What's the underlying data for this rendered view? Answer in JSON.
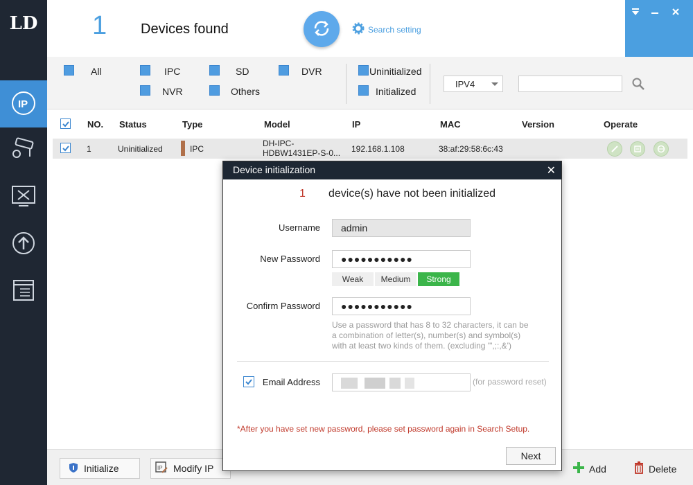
{
  "app": {
    "logo_text": "LD"
  },
  "header": {
    "count": "1",
    "found_label": "Devices found",
    "search_setting": "Search setting"
  },
  "filters": {
    "all": "All",
    "ipc": "IPC",
    "sd": "SD",
    "dvr": "DVR",
    "nvr": "NVR",
    "others": "Others",
    "uninitialized": "Uninitialized",
    "initialized": "Initialized",
    "ip_version": "IPV4",
    "search_value": ""
  },
  "table": {
    "headers": [
      "NO.",
      "Status",
      "Type",
      "Model",
      "IP",
      "MAC",
      "Version",
      "Operate"
    ],
    "rows": [
      {
        "no": "1",
        "status": "Uninitialized",
        "type": "IPC",
        "model_line1": "DH-IPC-",
        "model_line2": "HDBW1431EP-S-0...",
        "ip": "192.168.1.108",
        "mac": "38:af:29:58:6c:43",
        "version": ""
      }
    ]
  },
  "bottom": {
    "initialize": "Initialize",
    "modify_ip": "Modify IP",
    "add": "Add",
    "delete": "Delete"
  },
  "modal": {
    "title": "Device initialization",
    "count": "1",
    "message": "device(s) have not been initialized",
    "username_label": "Username",
    "username_value": "admin",
    "new_password_label": "New Password",
    "new_password_value": "●●●●●●●●●●●",
    "strength": [
      "Weak",
      "Medium",
      "Strong"
    ],
    "confirm_password_label": "Confirm Password",
    "confirm_password_value": "●●●●●●●●●●●",
    "hint_line1": "Use a password that has 8 to 32 characters, it can be",
    "hint_line2": "a combination of letter(s), number(s) and symbol(s)",
    "hint_line3": "with at least two kinds of them. (excluding '\",;:,&')",
    "email_label": "Email Address",
    "email_note": "(for password reset)",
    "warning": "*After you have set new password, please set password again in Search Setup.",
    "next": "Next"
  },
  "colors": {
    "accent": "#4b9fe0",
    "sidebar": "#1f2733",
    "strong": "#3bb54a",
    "warning": "#c0392b"
  }
}
